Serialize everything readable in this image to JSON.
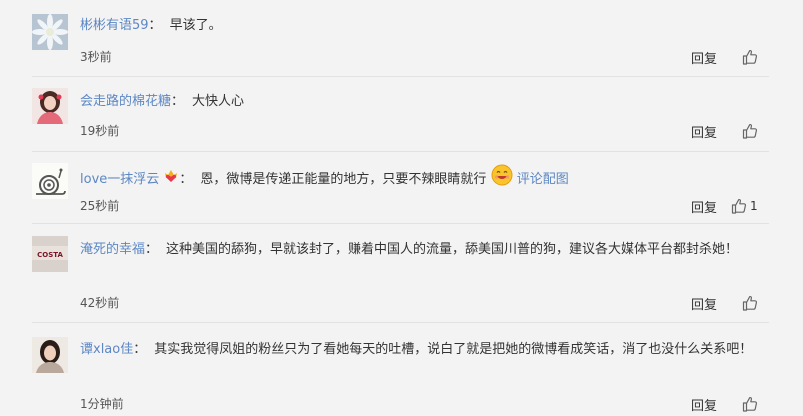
{
  "comments": [
    {
      "user": "彬彬有语59",
      "colon": "：",
      "text": "早该了。",
      "time": "3秒前",
      "reply": "回复",
      "likes": ""
    },
    {
      "user": "会走路的棉花糖",
      "colon": "：",
      "text": "大快人心",
      "time": "19秒前",
      "reply": "回复",
      "likes": ""
    },
    {
      "user": "love一抹浮云",
      "colon": "：",
      "text": "恩，微博是传递正能量的地方，只要不辣眼睛就行",
      "link": "评论配图",
      "time": "25秒前",
      "reply": "回复",
      "likes": "1",
      "badge_icon": "crown-heart-badge-icon",
      "emoji_icon": "grin-face-emoji-icon"
    },
    {
      "user": "淹死的幸福",
      "colon": "：",
      "text": "这种美国的舔狗，早就该封了，赚着中国人的流量，舔美国川普的狗，建议各大媒体平台都封杀她！",
      "avatar_text": "COSTA",
      "time": "42秒前",
      "reply": "回复",
      "likes": ""
    },
    {
      "user": "谭xlao佳",
      "colon": "：",
      "text": "其实我觉得凤姐的粉丝只为了看她每天的吐槽，说白了就是把她的微博看成笑话，消了也没什么关系吧！",
      "time": "1分钟前",
      "reply": "回复",
      "likes": ""
    }
  ],
  "colors": {
    "background": "#f3f3f3",
    "username": "#5c87c4",
    "divider": "#e2e2e2"
  }
}
